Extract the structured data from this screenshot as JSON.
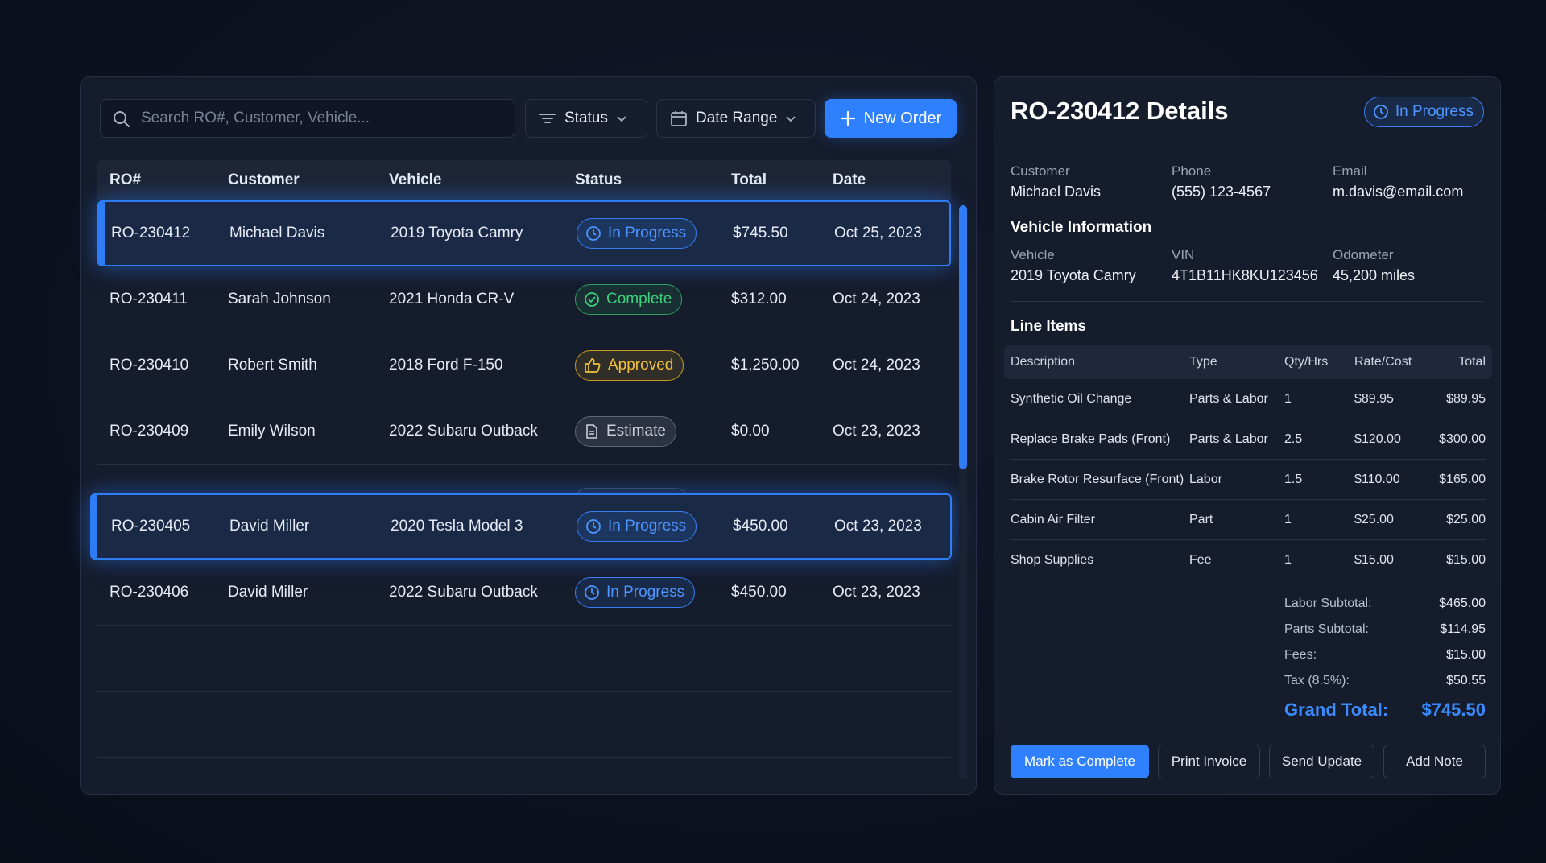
{
  "toolbar": {
    "search_placeholder": "Search RO#, Customer, Vehicle...",
    "status_label": "Status",
    "date_range_label": "Date Range",
    "new_order_label": "New Order"
  },
  "table": {
    "headers": [
      "RO#",
      "Customer",
      "Vehicle",
      "Status",
      "Total",
      "Date"
    ],
    "rows": [
      {
        "ro": "RO-230412",
        "customer": "Michael Davis",
        "vehicle": "2019 Toyota Camry",
        "status": "In Progress",
        "total": "$745.50",
        "date": "Oct 25, 2023"
      },
      {
        "ro": "RO-230411",
        "customer": "Sarah Johnson",
        "vehicle": "2021 Honda CR-V",
        "status": "Complete",
        "total": "$312.00",
        "date": "Oct 24, 2023"
      },
      {
        "ro": "RO-230410",
        "customer": "Robert Smith",
        "vehicle": "2018 Ford F-150",
        "status": "Approved",
        "total": "$1,250.00",
        "date": "Oct 24, 2023"
      },
      {
        "ro": "RO-230409",
        "customer": "Emily Wilson",
        "vehicle": "2022 Subaru Outback",
        "status": "Estimate",
        "total": "$0.00",
        "date": "Oct 23, 2023"
      },
      {
        "ro": "RO-230405",
        "customer": "David Miller",
        "vehicle": "2020 Tesla Model 3",
        "status": "In Progress",
        "total": "$450.00",
        "date": "Oct 23, 2023"
      },
      {
        "ro": "RO-230406",
        "customer": "David Miller",
        "vehicle": "2022 Subaru Outback",
        "status": "In Progress",
        "total": "$450.00",
        "date": "Oct 23, 2023"
      }
    ]
  },
  "details": {
    "title": "RO-230412 Details",
    "status": "In Progress",
    "customer_label": "Customer",
    "customer": "Michael Davis",
    "phone_label": "Phone",
    "phone": "(555) 123-4567",
    "email_label": "Email",
    "email": "m.davis@email.com",
    "vehicle_section": "Vehicle Information",
    "vehicle_label": "Vehicle",
    "vehicle": "2019 Toyota Camry",
    "vin_label": "VIN",
    "vin": "4T1B11HK8KU123456",
    "odometer_label": "Odometer",
    "odometer": "45,200 miles",
    "line_items_section": "Line Items",
    "line_headers": [
      "Description",
      "Type",
      "Qty/Hrs",
      "Rate/Cost",
      "Total"
    ],
    "line_items": [
      {
        "desc": "Synthetic Oil Change",
        "type": "Parts & Labor",
        "qty": "1",
        "rate": "$89.95",
        "total": "$89.95"
      },
      {
        "desc": "Replace Brake Pads (Front)",
        "type": "Parts & Labor",
        "qty": "2.5",
        "rate": "$120.00",
        "total": "$300.00"
      },
      {
        "desc": "Brake Rotor Resurface (Front)",
        "type": "Labor",
        "qty": "1.5",
        "rate": "$110.00",
        "total": "$165.00"
      },
      {
        "desc": "Cabin Air Filter",
        "type": "Part",
        "qty": "1",
        "rate": "$25.00",
        "total": "$25.00"
      },
      {
        "desc": "Shop Supplies",
        "type": "Fee",
        "qty": "1",
        "rate": "$15.00",
        "total": "$15.00"
      }
    ],
    "summary": {
      "labor_label": "Labor Subtotal:",
      "labor": "$465.00",
      "parts_label": "Parts Subtotal:",
      "parts": "$114.95",
      "fees_label": "Fees:",
      "fees": "$15.00",
      "tax_label": "Tax (8.5%):",
      "tax": "$50.55",
      "grand_label": "Grand Total:",
      "grand": "$745.50"
    },
    "actions": {
      "complete": "Mark as Complete",
      "print": "Print Invoice",
      "update": "Send Update",
      "note": "Add Note"
    }
  },
  "colors": {
    "accent": "#2f80ff",
    "in_progress": "#4f95ff",
    "complete": "#3fd07c",
    "approved": "#f4c23a",
    "estimate": "#c9ced9"
  }
}
